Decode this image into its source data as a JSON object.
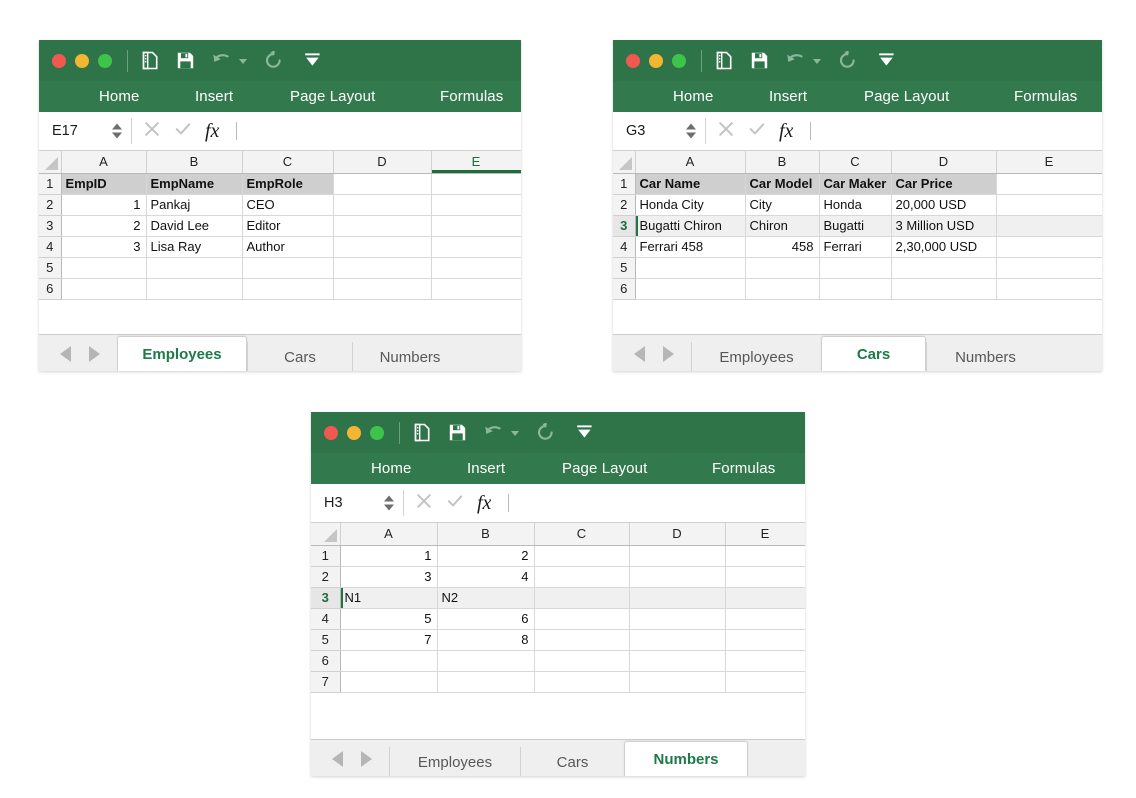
{
  "app": {
    "ribbon_tabs": [
      "Home",
      "Insert",
      "Page Layout",
      "Formulas"
    ],
    "quick_access": [
      "new-document-icon",
      "save-icon",
      "undo-icon",
      "undo-dropdown-icon",
      "redo-icon",
      "customize-toolbar-icon"
    ],
    "formula_bar": {
      "cancel_label": "✕",
      "confirm_label": "✓",
      "fx_label": "fx",
      "value": ""
    },
    "colors": {
      "ribbon_green": "#2f7449",
      "ribbon_tab_green": "#327a4d",
      "active_tab_text": "#1e7a46",
      "selection_green": "#217346",
      "header_fill": "#cfcfcf",
      "traffic_red": "#f1584f",
      "traffic_yellow": "#f2b632",
      "traffic_green": "#3ec449"
    }
  },
  "windows": [
    {
      "id": "employees",
      "name_box": "E17",
      "formula_value": "",
      "columns": [
        "A",
        "B",
        "C",
        "D",
        "E"
      ],
      "selected_column": "E",
      "selected_row": null,
      "rows": [
        {
          "num": "1",
          "cells": [
            {
              "v": "EmpID",
              "header": true
            },
            {
              "v": "EmpName",
              "header": true
            },
            {
              "v": "EmpRole",
              "header": true
            },
            {
              "v": ""
            },
            {
              "v": ""
            }
          ]
        },
        {
          "num": "2",
          "cells": [
            {
              "v": "1",
              "num": true
            },
            {
              "v": "Pankaj"
            },
            {
              "v": "CEO"
            },
            {
              "v": ""
            },
            {
              "v": ""
            }
          ]
        },
        {
          "num": "3",
          "cells": [
            {
              "v": "2",
              "num": true
            },
            {
              "v": "David Lee"
            },
            {
              "v": "Editor"
            },
            {
              "v": ""
            },
            {
              "v": ""
            }
          ]
        },
        {
          "num": "4",
          "cells": [
            {
              "v": "3",
              "num": true
            },
            {
              "v": "Lisa Ray"
            },
            {
              "v": "Author"
            },
            {
              "v": ""
            },
            {
              "v": ""
            }
          ]
        },
        {
          "num": "5",
          "cells": [
            {
              "v": ""
            },
            {
              "v": ""
            },
            {
              "v": ""
            },
            {
              "v": ""
            },
            {
              "v": ""
            }
          ]
        },
        {
          "num": "6",
          "cells": [
            {
              "v": ""
            },
            {
              "v": ""
            },
            {
              "v": ""
            },
            {
              "v": ""
            },
            {
              "v": ""
            }
          ]
        }
      ],
      "sheet_tabs": [
        {
          "label": "Employees",
          "active": true
        },
        {
          "label": "Cars",
          "active": false
        },
        {
          "label": "Numbers",
          "active": false
        }
      ]
    },
    {
      "id": "cars",
      "name_box": "G3",
      "formula_value": "",
      "columns": [
        "A",
        "B",
        "C",
        "D",
        "E"
      ],
      "selected_column": null,
      "selected_row": "3",
      "rows": [
        {
          "num": "1",
          "cells": [
            {
              "v": "Car Name",
              "header": true
            },
            {
              "v": "Car Model",
              "header": true
            },
            {
              "v": "Car Maker",
              "header": true
            },
            {
              "v": "Car Price",
              "header": true
            },
            {
              "v": ""
            }
          ]
        },
        {
          "num": "2",
          "cells": [
            {
              "v": "Honda City"
            },
            {
              "v": "City"
            },
            {
              "v": "Honda"
            },
            {
              "v": "20,000 USD"
            },
            {
              "v": ""
            }
          ]
        },
        {
          "num": "3",
          "cells": [
            {
              "v": "Bugatti Chiron",
              "mark": true
            },
            {
              "v": "Chiron"
            },
            {
              "v": "Bugatti"
            },
            {
              "v": "3 Million USD"
            },
            {
              "v": ""
            }
          ]
        },
        {
          "num": "4",
          "cells": [
            {
              "v": "Ferrari 458"
            },
            {
              "v": "458",
              "num": true
            },
            {
              "v": "Ferrari"
            },
            {
              "v": "2,30,000 USD"
            },
            {
              "v": ""
            }
          ]
        },
        {
          "num": "5",
          "cells": [
            {
              "v": ""
            },
            {
              "v": ""
            },
            {
              "v": ""
            },
            {
              "v": ""
            },
            {
              "v": ""
            }
          ]
        },
        {
          "num": "6",
          "cells": [
            {
              "v": ""
            },
            {
              "v": ""
            },
            {
              "v": ""
            },
            {
              "v": ""
            },
            {
              "v": ""
            }
          ]
        }
      ],
      "sheet_tabs": [
        {
          "label": "Employees",
          "active": false
        },
        {
          "label": "Cars",
          "active": true
        },
        {
          "label": "Numbers",
          "active": false
        }
      ]
    },
    {
      "id": "numbers",
      "name_box": "H3",
      "formula_value": "",
      "columns": [
        "A",
        "B",
        "C",
        "D",
        "E"
      ],
      "selected_column": null,
      "selected_row": "3",
      "rows": [
        {
          "num": "1",
          "cells": [
            {
              "v": "1",
              "num": true
            },
            {
              "v": "2",
              "num": true
            },
            {
              "v": ""
            },
            {
              "v": ""
            },
            {
              "v": ""
            }
          ]
        },
        {
          "num": "2",
          "cells": [
            {
              "v": "3",
              "num": true
            },
            {
              "v": "4",
              "num": true
            },
            {
              "v": ""
            },
            {
              "v": ""
            },
            {
              "v": ""
            }
          ]
        },
        {
          "num": "3",
          "cells": [
            {
              "v": "N1",
              "mark": true
            },
            {
              "v": "N2"
            },
            {
              "v": ""
            },
            {
              "v": ""
            },
            {
              "v": ""
            }
          ]
        },
        {
          "num": "4",
          "cells": [
            {
              "v": "5",
              "num": true
            },
            {
              "v": "6",
              "num": true
            },
            {
              "v": ""
            },
            {
              "v": ""
            },
            {
              "v": ""
            }
          ]
        },
        {
          "num": "5",
          "cells": [
            {
              "v": "7",
              "num": true
            },
            {
              "v": "8",
              "num": true
            },
            {
              "v": ""
            },
            {
              "v": ""
            },
            {
              "v": ""
            }
          ]
        },
        {
          "num": "6",
          "cells": [
            {
              "v": ""
            },
            {
              "v": ""
            },
            {
              "v": ""
            },
            {
              "v": ""
            },
            {
              "v": ""
            }
          ]
        },
        {
          "num": "7",
          "cells": [
            {
              "v": ""
            },
            {
              "v": ""
            },
            {
              "v": ""
            },
            {
              "v": ""
            },
            {
              "v": ""
            }
          ]
        }
      ],
      "sheet_tabs": [
        {
          "label": "Employees",
          "active": false
        },
        {
          "label": "Cars",
          "active": false
        },
        {
          "label": "Numbers",
          "active": true
        }
      ]
    }
  ]
}
